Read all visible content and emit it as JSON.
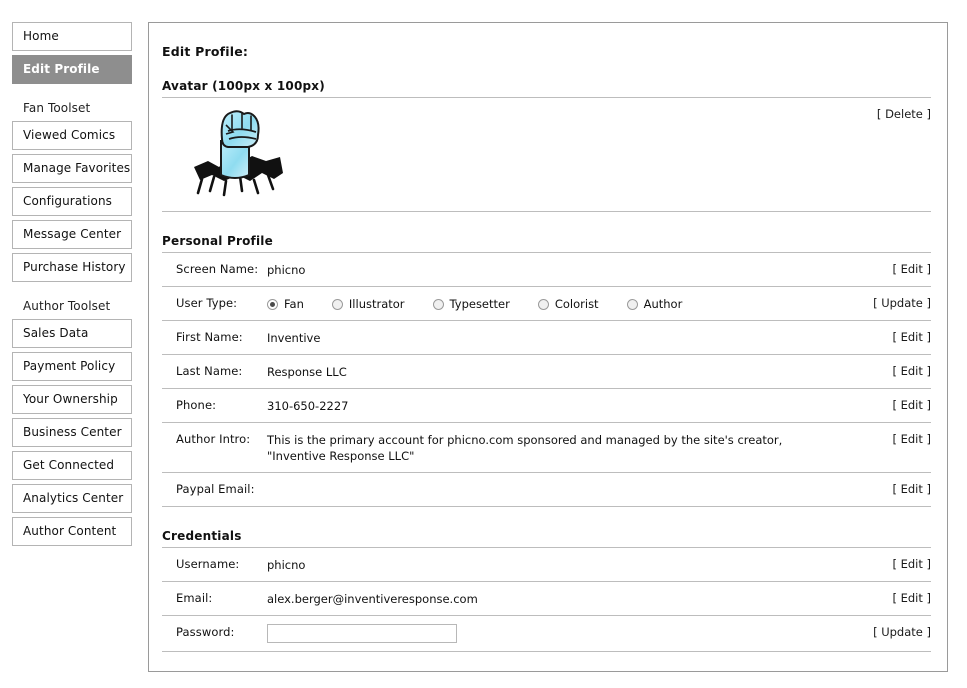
{
  "sidebar": {
    "top_items": [
      {
        "label": "Home",
        "active": false
      },
      {
        "label": "Edit Profile",
        "active": true
      }
    ],
    "groups": [
      {
        "title": "Fan Toolset",
        "items": [
          {
            "label": "Viewed Comics"
          },
          {
            "label": "Manage Favorites"
          },
          {
            "label": "Configurations"
          },
          {
            "label": "Message Center"
          },
          {
            "label": "Purchase History"
          }
        ]
      },
      {
        "title": "Author Toolset",
        "items": [
          {
            "label": "Sales Data"
          },
          {
            "label": "Payment Policy"
          },
          {
            "label": "Your Ownership"
          },
          {
            "label": "Business Center"
          },
          {
            "label": "Get Connected"
          },
          {
            "label": "Analytics Center"
          },
          {
            "label": "Author Content"
          }
        ]
      }
    ]
  },
  "main": {
    "page_title": "Edit Profile:",
    "avatar_section": {
      "heading": "Avatar (100px x 100px)",
      "delete_label": "[ Delete ]",
      "avatar_alt": "raised-fist-avatar"
    },
    "personal_profile": {
      "heading": "Personal Profile",
      "rows": [
        {
          "label": "Screen Name:",
          "value": "phicno",
          "action": "[ Edit ]"
        },
        {
          "label": "First Name:",
          "value": "Inventive",
          "action": "[ Edit ]"
        },
        {
          "label": "Last Name:",
          "value": "Response LLC",
          "action": "[ Edit ]"
        },
        {
          "label": "Phone:",
          "value": "310-650-2227",
          "action": "[ Edit ]"
        },
        {
          "label": "Paypal Email:",
          "value": "",
          "action": "[ Edit ]"
        }
      ],
      "user_type": {
        "label": "User Type:",
        "action": "[ Update ]",
        "options": [
          {
            "label": "Fan",
            "selected": true
          },
          {
            "label": "Illustrator",
            "selected": false
          },
          {
            "label": "Typesetter",
            "selected": false
          },
          {
            "label": "Colorist",
            "selected": false
          },
          {
            "label": "Author",
            "selected": false
          }
        ]
      },
      "author_intro": {
        "label": "Author Intro:",
        "line1": "This is the primary account for phicno.com sponsored and managed by the site's creator,",
        "line2": "\"Inventive Response LLC\"",
        "action": "[ Edit ]"
      }
    },
    "credentials": {
      "heading": "Credentials",
      "rows": [
        {
          "label": "Username:",
          "value": "phicno",
          "action": "[ Edit ]"
        },
        {
          "label": "Email:",
          "value": "alex.berger@inventiveresponse.com",
          "action": "[ Edit ]"
        }
      ],
      "password": {
        "label": "Password:",
        "value": "",
        "placeholder": "",
        "action": "[ Update ]"
      }
    }
  },
  "colors": {
    "active_nav_bg": "#8e8e8e",
    "border": "#b4b4b4",
    "rule": "#bdbdbd",
    "avatar_fist": "#9be3f4"
  }
}
